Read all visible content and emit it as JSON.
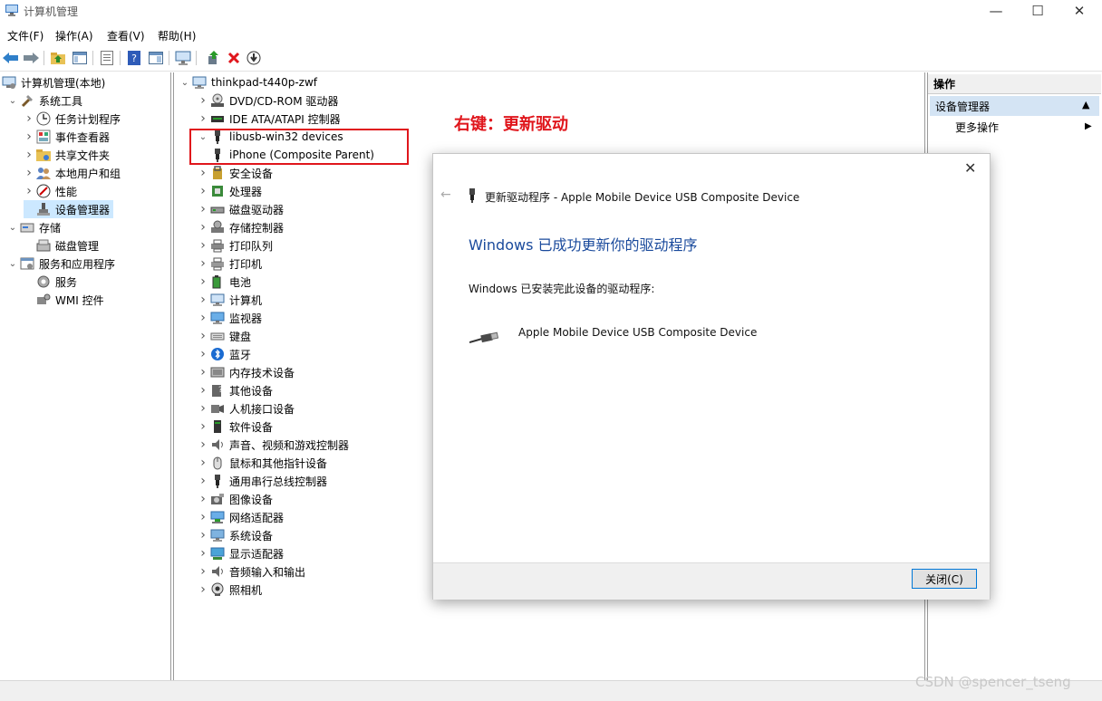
{
  "window": {
    "title": "计算机管理"
  },
  "menu": [
    "文件(F)",
    "操作(A)",
    "查看(V)",
    "帮助(H)"
  ],
  "toolbar_icons": [
    "back-icon",
    "forward-icon",
    "up-folder-icon",
    "show-tree-icon",
    "properties-icon",
    "help-icon",
    "console-icon",
    "monitor-icon",
    "update-driver-icon",
    "uninstall-icon",
    "download-icon"
  ],
  "left_tree": [
    {
      "label": "计算机管理(本地)",
      "level": 0,
      "expand": "",
      "icon": "computer-mgmt-icon"
    },
    {
      "label": "系统工具",
      "level": 1,
      "expand": "v",
      "icon": "tools-icon"
    },
    {
      "label": "任务计划程序",
      "level": 2,
      "expand": ">",
      "icon": "clock-icon"
    },
    {
      "label": "事件查看器",
      "level": 2,
      "expand": ">",
      "icon": "event-viewer-icon"
    },
    {
      "label": "共享文件夹",
      "level": 2,
      "expand": ">",
      "icon": "shared-folder-icon"
    },
    {
      "label": "本地用户和组",
      "level": 2,
      "expand": ">",
      "icon": "users-icon"
    },
    {
      "label": "性能",
      "level": 2,
      "expand": ">",
      "icon": "performance-icon"
    },
    {
      "label": "设备管理器",
      "level": 2,
      "expand": "",
      "icon": "device-manager-icon",
      "selected": true
    },
    {
      "label": "存储",
      "level": 1,
      "expand": "v",
      "icon": "storage-icon"
    },
    {
      "label": "磁盘管理",
      "level": 2,
      "expand": "",
      "icon": "disk-management-icon"
    },
    {
      "label": "服务和应用程序",
      "level": 1,
      "expand": "v",
      "icon": "services-apps-icon"
    },
    {
      "label": "服务",
      "level": 2,
      "expand": "",
      "icon": "services-icon"
    },
    {
      "label": "WMI 控件",
      "level": 2,
      "expand": "",
      "icon": "wmi-icon"
    }
  ],
  "device_tree": {
    "root": "thinkpad-t440p-zwf",
    "items": [
      {
        "label": "DVD/CD-ROM 驱动器",
        "icon": "dvd-icon",
        "expand": ">"
      },
      {
        "label": "IDE ATA/ATAPI 控制器",
        "icon": "ide-icon",
        "expand": ">"
      },
      {
        "label": "libusb-win32 devices",
        "icon": "usb-plug-icon",
        "expand": "v"
      },
      {
        "label": "iPhone (Composite Parent)",
        "icon": "usb-plug-icon",
        "expand": "",
        "child": true
      },
      {
        "label": "安全设备",
        "icon": "security-device-icon",
        "expand": ">"
      },
      {
        "label": "处理器",
        "icon": "processor-icon",
        "expand": ">"
      },
      {
        "label": "磁盘驱动器",
        "icon": "disk-drive-icon",
        "expand": ">"
      },
      {
        "label": "存储控制器",
        "icon": "storage-controller-icon",
        "expand": ">"
      },
      {
        "label": "打印队列",
        "icon": "print-queue-icon",
        "expand": ">"
      },
      {
        "label": "打印机",
        "icon": "printer-icon",
        "expand": ">"
      },
      {
        "label": "电池",
        "icon": "battery-icon",
        "expand": ">"
      },
      {
        "label": "计算机",
        "icon": "computer-icon",
        "expand": ">"
      },
      {
        "label": "监视器",
        "icon": "monitor-icon",
        "expand": ">"
      },
      {
        "label": "键盘",
        "icon": "keyboard-icon",
        "expand": ">"
      },
      {
        "label": "蓝牙",
        "icon": "bluetooth-icon",
        "expand": ">"
      },
      {
        "label": "内存技术设备",
        "icon": "memory-icon",
        "expand": ">"
      },
      {
        "label": "其他设备",
        "icon": "other-device-icon",
        "expand": ">"
      },
      {
        "label": "人机接口设备",
        "icon": "hid-icon",
        "expand": ">"
      },
      {
        "label": "软件设备",
        "icon": "software-device-icon",
        "expand": ">"
      },
      {
        "label": "声音、视频和游戏控制器",
        "icon": "speaker-icon",
        "expand": ">"
      },
      {
        "label": "鼠标和其他指针设备",
        "icon": "mouse-icon",
        "expand": ">"
      },
      {
        "label": "通用串行总线控制器",
        "icon": "usb-plug-icon",
        "expand": ">"
      },
      {
        "label": "图像设备",
        "icon": "imaging-icon",
        "expand": ">"
      },
      {
        "label": "网络适配器",
        "icon": "network-adapter-icon",
        "expand": ">"
      },
      {
        "label": "系统设备",
        "icon": "system-device-icon",
        "expand": ">"
      },
      {
        "label": "显示适配器",
        "icon": "display-adapter-icon",
        "expand": ">"
      },
      {
        "label": "音频输入和输出",
        "icon": "speaker-icon",
        "expand": ">"
      },
      {
        "label": "照相机",
        "icon": "camera-icon",
        "expand": ">"
      }
    ]
  },
  "actions_pane": {
    "header": "操作",
    "section": "设备管理器",
    "more": "更多操作"
  },
  "annotation": "右键：更新驱动",
  "dialog": {
    "nav_title": "更新驱动程序 - Apple Mobile Device USB Composite Device",
    "heading": "Windows 已成功更新你的驱动程序",
    "message": "Windows 已安装完此设备的驱动程序:",
    "device_name": "Apple Mobile Device USB Composite Device",
    "close_button": "关闭(C)"
  },
  "watermark": "CSDN @spencer_tseng",
  "colors": {
    "accent": "#0078d7",
    "heading_blue": "#1a4a9c",
    "annotation_red": "#e0161c",
    "selection": "#cce8ff"
  }
}
